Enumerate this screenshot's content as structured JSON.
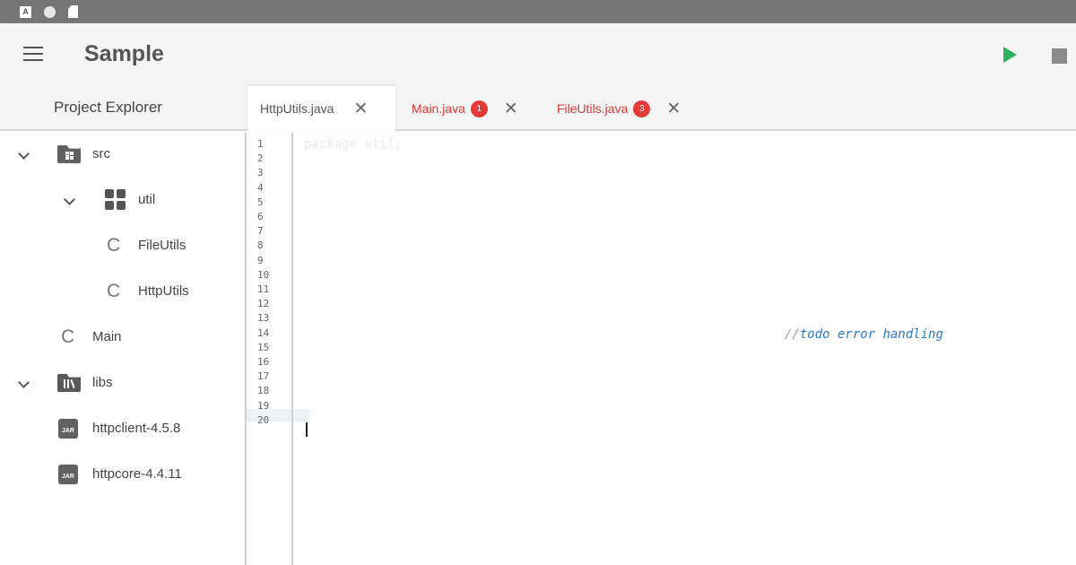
{
  "app": {
    "title": "Sample"
  },
  "toolbar": {
    "menu_icon": "hamburger-menu-icon",
    "run_icon": "play-icon",
    "stop_icon": "stop-icon",
    "run_color": "#2fb35a"
  },
  "explorer": {
    "title": "Project Explorer",
    "items": [
      {
        "label": "src",
        "icon": "source-folder-icon",
        "expanded": true
      },
      {
        "label": "util",
        "icon": "package-icon",
        "expanded": true
      },
      {
        "label": "FileUtils",
        "icon": "class-icon"
      },
      {
        "label": "HttpUtils",
        "icon": "class-icon"
      },
      {
        "label": "Main",
        "icon": "class-icon"
      },
      {
        "label": "libs",
        "icon": "library-folder-icon",
        "expanded": true
      },
      {
        "label": "httpclient-4.5.8",
        "icon": "jar-icon"
      },
      {
        "label": "httpcore-4.4.11",
        "icon": "jar-icon"
      }
    ],
    "jar_badge": "JAR"
  },
  "tabs": [
    {
      "label": "HttpUtils.java",
      "active": true,
      "error": false
    },
    {
      "label": "Main.java",
      "active": false,
      "error": true,
      "badge": "1"
    },
    {
      "label": "FileUtils.java",
      "active": false,
      "error": true,
      "badge": "3"
    }
  ],
  "editor": {
    "line_numbers": [
      "1",
      "2",
      "3",
      "4",
      "5",
      "6",
      "7",
      "8",
      "9",
      "10",
      "11",
      "12",
      "13",
      "14",
      "15",
      "16",
      "17",
      "18",
      "19",
      "20"
    ],
    "code_first_line": "package util;",
    "comment_slashes": "//",
    "comment_text": "todo error handling",
    "comment_color": "#2a7bd6",
    "error_color": "#e53935"
  }
}
